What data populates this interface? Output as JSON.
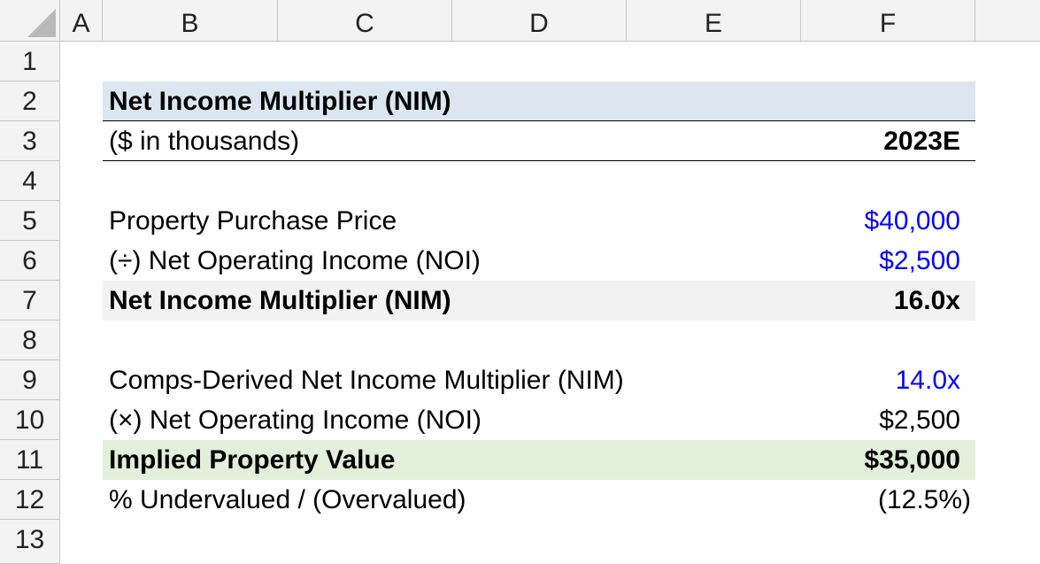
{
  "columns": [
    "A",
    "B",
    "C",
    "D",
    "E",
    "F"
  ],
  "rows": [
    "1",
    "2",
    "3",
    "4",
    "5",
    "6",
    "7",
    "8",
    "9",
    "10",
    "11",
    "12",
    "13"
  ],
  "colors": {
    "input_blue": "#0000ff",
    "header_fill": "#dce6f1",
    "subtotal_fill": "#f2f2f2",
    "result_fill": "#e2efda"
  },
  "sheet": {
    "title": "Net Income Multiplier (NIM)",
    "units": "($ in thousands)",
    "period": "2023E",
    "purchase_price_label": "Property Purchase Price",
    "purchase_price_value": "$40,000",
    "noi_label_div": "(÷) Net Operating Income (NOI)",
    "noi_value_div": "$2,500",
    "nim_label": "Net Income Multiplier (NIM)",
    "nim_value": "16.0x",
    "comps_nim_label": "Comps-Derived Net Income Multiplier (NIM)",
    "comps_nim_value": "14.0x",
    "noi_label_mult": "(×) Net Operating Income (NOI)",
    "noi_value_mult": "$2,500",
    "implied_label": "Implied Property Value",
    "implied_value": "$35,000",
    "undervalued_label": "% Undervalued / (Overvalued)",
    "undervalued_value": "(12.5%)"
  }
}
